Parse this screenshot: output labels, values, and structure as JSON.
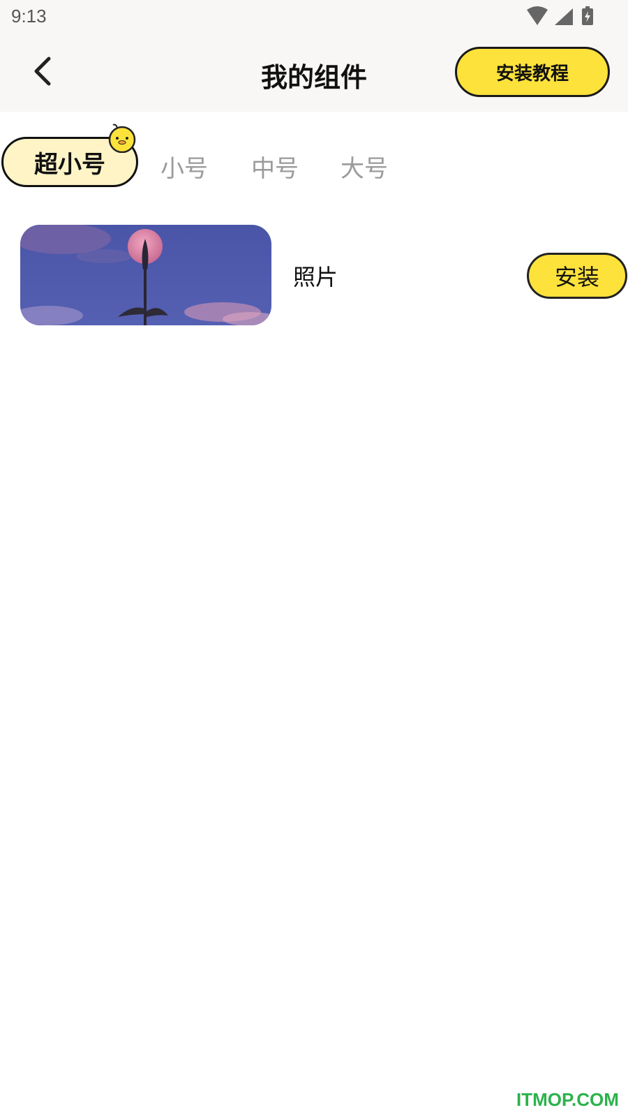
{
  "status_bar": {
    "time": "9:13",
    "icons": [
      "wifi-icon",
      "signal-icon",
      "battery-charging-icon"
    ]
  },
  "header": {
    "title": "我的组件",
    "tutorial_label": "安装教程",
    "back_icon": "chevron-left-icon"
  },
  "tabs": [
    {
      "label": "超小号",
      "active": true
    },
    {
      "label": "小号",
      "active": false
    },
    {
      "label": "中号",
      "active": false
    },
    {
      "label": "大号",
      "active": false
    }
  ],
  "widgets": [
    {
      "name": "照片",
      "install_label": "安装",
      "thumbnail": "moon-flower-photo"
    }
  ],
  "watermark": "ITMOP.COM",
  "colors": {
    "accent_yellow": "#fde23c",
    "active_tab_bg": "#fef4c6",
    "header_bg": "#f8f7f5",
    "inactive_tab": "#9a9a9a"
  }
}
